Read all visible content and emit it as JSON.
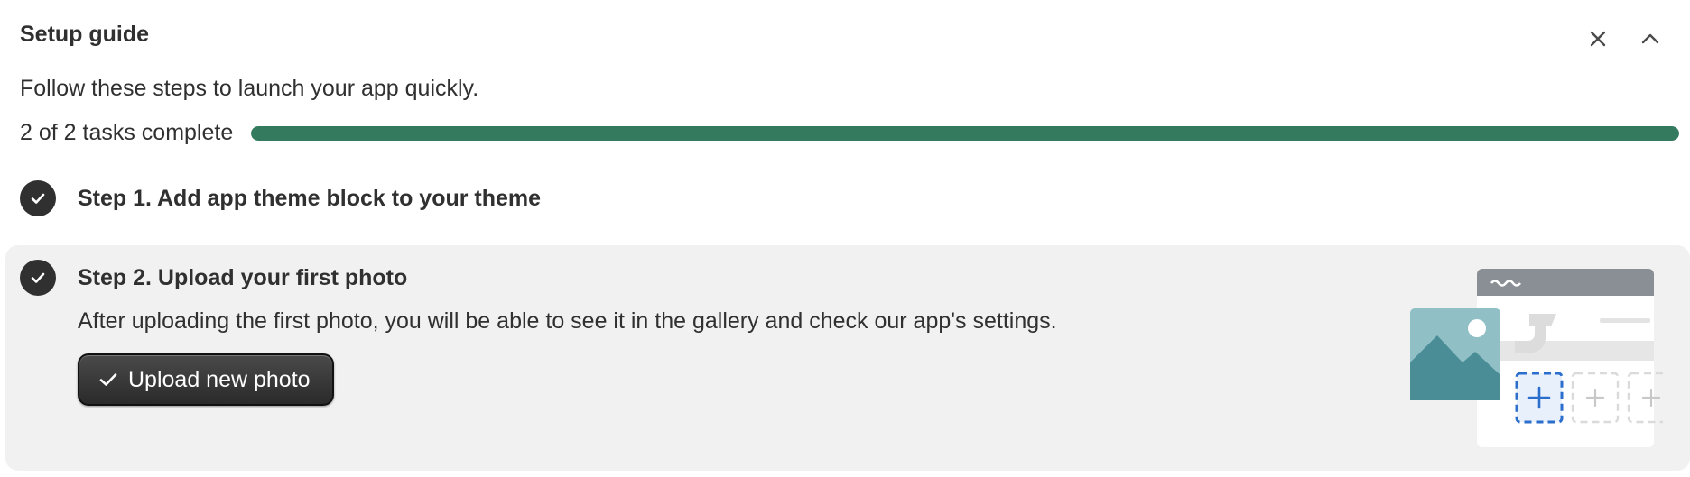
{
  "header": {
    "title": "Setup guide",
    "close_icon": "close-icon",
    "collapse_icon": "chevron-up-icon"
  },
  "subtitle": "Follow these steps to launch your app quickly.",
  "progress": {
    "label": "2 of 2 tasks complete",
    "completed": 2,
    "total": 2,
    "fraction": 1.0,
    "color": "#347a5f"
  },
  "steps": [
    {
      "title": "Step 1. Add app theme block to your theme",
      "complete": true,
      "icon": "check-circle-icon"
    },
    {
      "title": "Step 2. Upload your first photo",
      "complete": true,
      "icon": "check-circle-icon",
      "description": "After uploading the first photo, you will be able to see it in the gallery and check our app's settings.",
      "button_label": "Upload new photo",
      "button_icon": "check-icon",
      "illustration": "gallery-upload-illustration"
    }
  ],
  "colors": {
    "panel_bg": "#f1f1f1",
    "text": "#303030",
    "button_bg": "#303030",
    "accent_blue": "#2c6ecb"
  }
}
